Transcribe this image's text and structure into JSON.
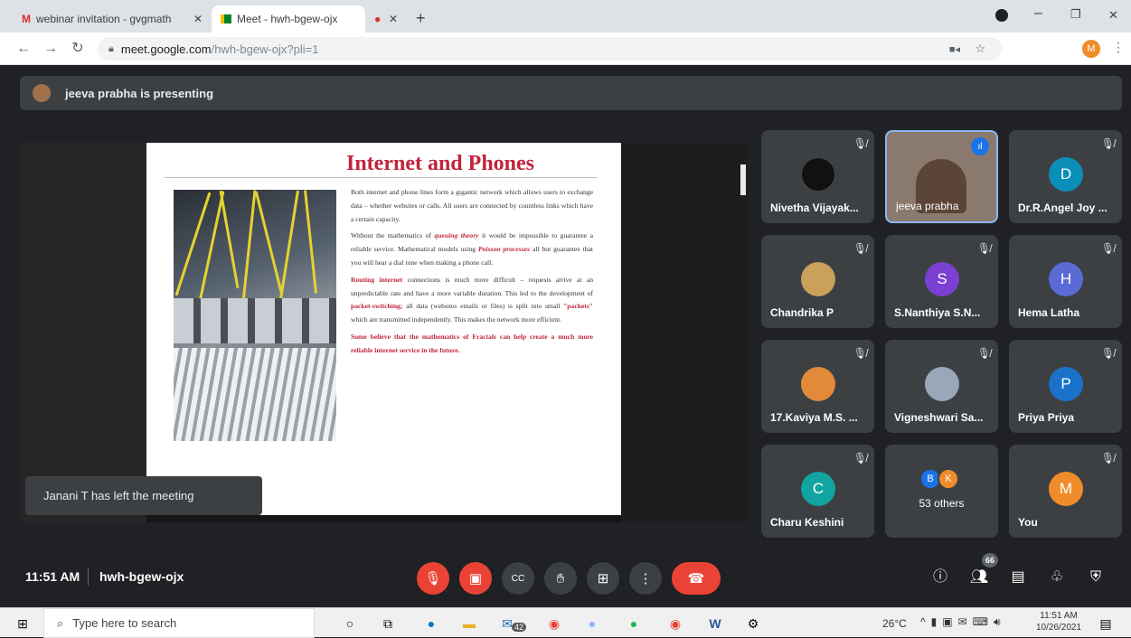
{
  "browser": {
    "tabs": [
      {
        "label": "webinar invitation - gvgmathsaid",
        "icon": "gmail-icon"
      },
      {
        "label": "Meet - hwh-bgew-ojx",
        "icon": "meet-icon"
      },
      {
        "label": "",
        "icon": "recording-dot-icon"
      }
    ],
    "url_host": "meet.google.com",
    "url_path": "/hwh-bgew-ojx?pli=1",
    "profile_initial": "M"
  },
  "meet": {
    "presenting_text": "jeeva prabha is presenting",
    "toast": "Janani T has left the meeting",
    "slide": {
      "title": "Internet and Phones",
      "p1": "Both internet and phone lines form a gigantic network which allows users to exchange data – whether websites or calls. All users are connected by countless links which have a certain capacity.",
      "p2a": "Without the mathematics of ",
      "p2b": "queuing theory",
      "p2c": " it would be impossible to guarantee a reliable service. Mathematical models using ",
      "p2d": "Poisson processes",
      "p2e": " all but guarantee that you will hear a dial tone when making a phone call.",
      "p3a": "Routing internet",
      "p3b": " connections is much more difficult – requests arrive at an unpredictable rate and have a more variable duration. This led to the development of ",
      "p3c": "packet-switching;",
      "p3d": " all data (websites emails or files) is split into small ",
      "p3e": "\"packets\"",
      "p3f": " which are transmitted independently. This makes the network more efficient.",
      "p4": "Some believe that the mathematics of Fractals can help create a much more reliable internet service in the future."
    },
    "participants": [
      {
        "name": "Nivetha Vijayak...",
        "avatar": "",
        "color": "#111111"
      },
      {
        "name": "jeeva prabha",
        "avatar": "",
        "color": "#8a7a6e"
      },
      {
        "name": "Dr.R.Angel Joy ...",
        "avatar": "D",
        "color": "#0b8fb8"
      },
      {
        "name": "Chandrika P",
        "avatar": "",
        "color": "#c9a15a"
      },
      {
        "name": "S.Nanthiya S.N...",
        "avatar": "S",
        "color": "#7b3fd1"
      },
      {
        "name": "Hema Latha",
        "avatar": "H",
        "color": "#5b6bd6"
      },
      {
        "name": "17.Kaviya M.S. ...",
        "avatar": "",
        "color": "#e28a3a"
      },
      {
        "name": "Vigneshwari Sa...",
        "avatar": "",
        "color": "#9aa7b8"
      },
      {
        "name": "Priya Priya",
        "avatar": "P",
        "color": "#1a73c8"
      },
      {
        "name": "Charu Keshini",
        "avatar": "C",
        "color": "#12a4a0"
      },
      {
        "name": "53 others",
        "avatar": "",
        "color": "#3c4043"
      },
      {
        "name": "You",
        "avatar": "M",
        "color": "#f08c2a"
      }
    ],
    "others_avatars": [
      "B",
      "K"
    ],
    "time": "11:51 AM",
    "meeting_code": "hwh-bgew-ojx",
    "people_count": "66"
  },
  "taskbar": {
    "search_placeholder": "Type here to search",
    "mail_badge": "42",
    "weather": "26°C",
    "clock_time": "11:51 AM",
    "clock_date": "10/26/2021"
  }
}
